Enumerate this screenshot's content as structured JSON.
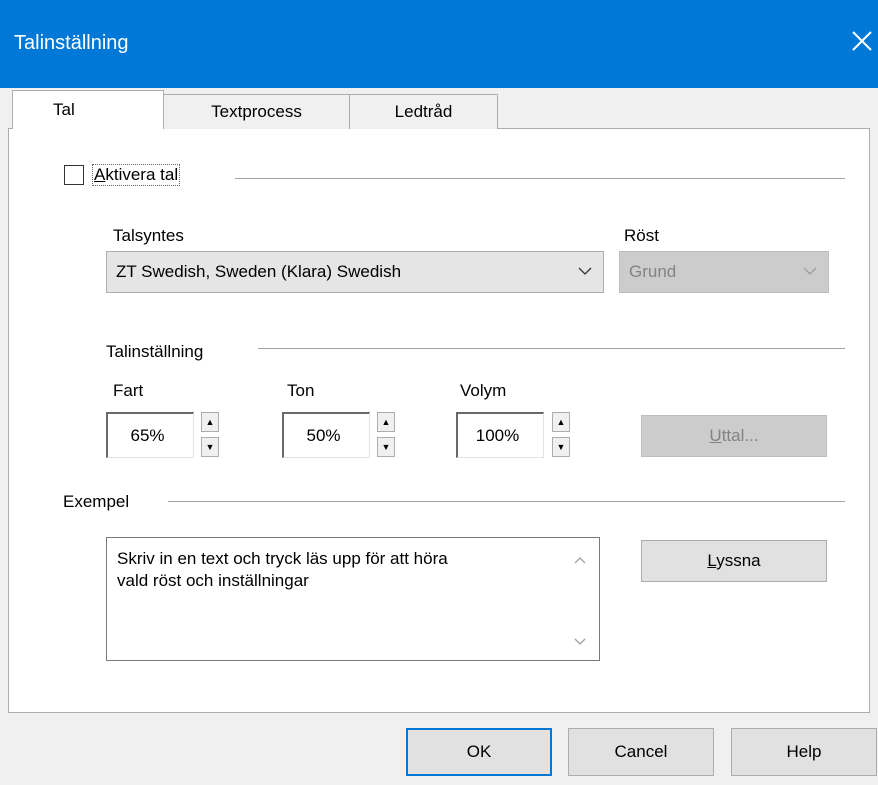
{
  "window": {
    "title": "Talinställning"
  },
  "tabs": [
    {
      "label": "Tal",
      "active": true
    },
    {
      "label": "Textprocess",
      "active": false
    },
    {
      "label": "Ledtråd",
      "active": false
    }
  ],
  "activate": {
    "label_first": "A",
    "label_rest": "ktivera tal",
    "checked": false
  },
  "synth": {
    "label": "Talsyntes",
    "value": "ZT Swedish, Sweden  (Klara) Swedish"
  },
  "voice": {
    "label": "Röst",
    "value": "Grund",
    "disabled": true
  },
  "settings": {
    "group_label": "Talinställning",
    "speed": {
      "label": "Fart",
      "value": "65%"
    },
    "pitch": {
      "label": "Ton",
      "value": "50%"
    },
    "volume": {
      "label": "Volym",
      "value": "100%"
    },
    "pronunciation_first": "U",
    "pronunciation_rest": "ttal...",
    "pronunciation_disabled": true
  },
  "example": {
    "group_label": "Exempel",
    "text": "Skriv in en text och tryck läs upp för att höra\nvald röst och inställningar",
    "listen_first": "L",
    "listen_rest": "yssna"
  },
  "footer": {
    "ok": "OK",
    "cancel": "Cancel",
    "help": "Help"
  },
  "colors": {
    "titlebar": "#0078d7",
    "dialog_bg": "#f0f0f0",
    "panel_bg": "#ffffff",
    "disabled_fill": "#cccccc"
  },
  "icons": {
    "close": "close-icon",
    "combo_arrow": "chevron-down-icon",
    "spin_up": "arrow-up-icon",
    "spin_down": "arrow-down-icon",
    "scroll_up": "chevron-up-icon",
    "scroll_down": "chevron-down-icon"
  }
}
